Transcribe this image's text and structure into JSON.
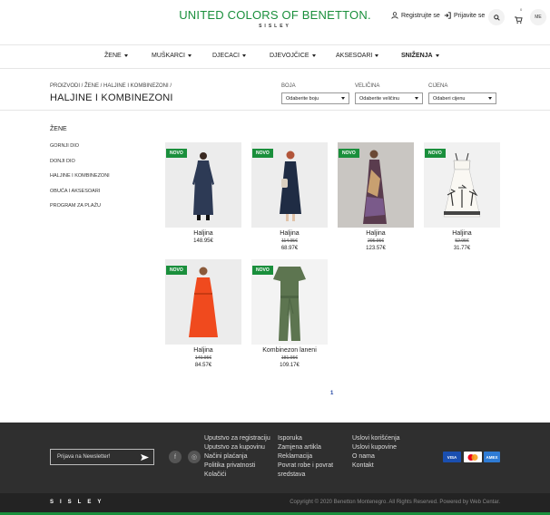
{
  "header": {
    "logo": "UNITED COLORS OF BENETTON.",
    "logo_sub": "SISLEY",
    "register": "Registrujte se",
    "login": "Prijavite se",
    "lang": "ME",
    "cart_count": "0"
  },
  "nav": [
    {
      "label": "ŽENE"
    },
    {
      "label": "MUŠKARCI"
    },
    {
      "label": "DJECACI"
    },
    {
      "label": "DJEVOJČICE"
    },
    {
      "label": "AKSESOARI"
    },
    {
      "label": "SNIŽENJA"
    }
  ],
  "page": {
    "breadcrumb": "PROIZVODI / ŽENE / HALJINE I KOMBINEZONI /",
    "title": "HALJINE I KOMBINEZONI"
  },
  "filters": [
    {
      "label": "BOJA",
      "value": "Odaberite boju"
    },
    {
      "label": "VELIČINA",
      "value": "Odaberite veličinu"
    },
    {
      "label": "CIJENA",
      "value": "Odaberi cijenu"
    }
  ],
  "sidebar": {
    "title": "ŽENE",
    "items": [
      "GORNJI DIO",
      "DONJI DIO",
      "HALJINE I KOMBINEZONI",
      "OBUĆA I AKSESOARI",
      "PROGRAM ZA PLAŽU"
    ]
  },
  "products": [
    {
      "badge": "NOVO",
      "name": "Haljina",
      "old_price": "",
      "price": "148.95€"
    },
    {
      "badge": "NOVO",
      "name": "Haljina",
      "old_price": "114.95€",
      "price": "68.97€"
    },
    {
      "badge": "NOVO",
      "name": "Haljina",
      "old_price": "205.95€",
      "price": "123.57€"
    },
    {
      "badge": "NOVO",
      "name": "Haljina",
      "old_price": "52.95€",
      "price": "31.77€"
    },
    {
      "badge": "NOVO",
      "name": "Haljina",
      "old_price": "140.95€",
      "price": "84.57€"
    },
    {
      "badge": "NOVO",
      "name": "Kombinezon laneni",
      "old_price": "181.95€",
      "price": "109.17€"
    }
  ],
  "pagination": {
    "current": "1"
  },
  "footer": {
    "newsletter_placeholder": "Prijava na Newsletter!",
    "col1": [
      "Uputstvo za registraciju",
      "Uputstvo za kupovinu",
      "Načini plaćanja",
      "Politika privatnosti",
      "Kolačići"
    ],
    "col2": [
      "Isporuka",
      "Zamjena artikla",
      "Reklamacija",
      "Povrat robe i povrat",
      "sredstava"
    ],
    "col3": [
      "Uslovi korišćenja",
      "Uslovi kupovine",
      "O nama",
      "Kontakt"
    ],
    "payments": [
      "VISA",
      "MC",
      "AMEX"
    ],
    "bottom_logo": "SISLEY",
    "copyright": "Copyright © 2020 Benetton Montenegro. All Rights Reserved. Powered by Web Centar."
  },
  "colors": {
    "brand_green": "#1a8f3c",
    "footer_bg": "#2f2f2f"
  }
}
